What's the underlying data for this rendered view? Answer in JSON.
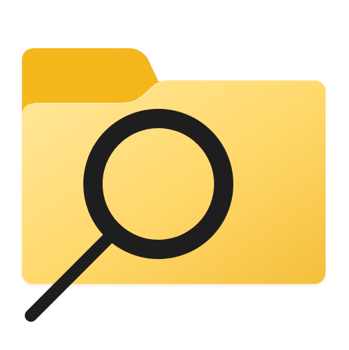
{
  "icon": {
    "name": "folder-search-icon",
    "colors": {
      "background": "#ffffff",
      "folder_back": "#f2b91f",
      "folder_front_light": "#ffe38f",
      "folder_front_dark": "#f7c340",
      "folder_tab_edge": "#e9a912",
      "magnifier": "#1c1c1c",
      "magnifier_shadow": "#000000"
    }
  }
}
